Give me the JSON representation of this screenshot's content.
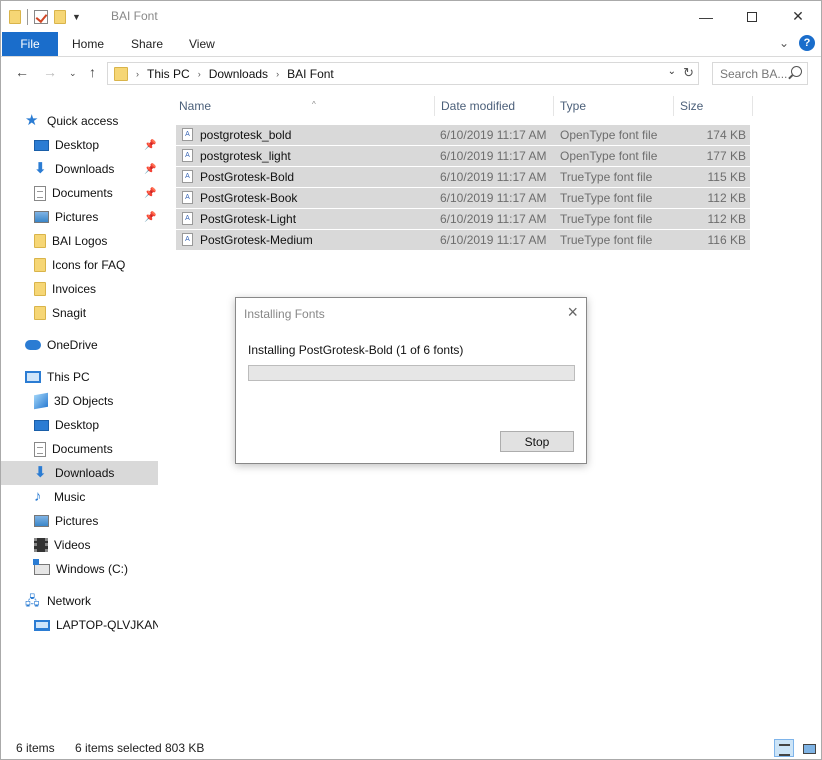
{
  "window": {
    "title": "BAI Font",
    "controls": {
      "minimize": "—",
      "maximize": "",
      "close": "✕"
    }
  },
  "ribbon": {
    "tabs": [
      "File",
      "Home",
      "Share",
      "View"
    ],
    "expand": "⌄",
    "help": "?"
  },
  "navbar": {
    "back": "←",
    "forward": "→",
    "recent": "⌄",
    "up": "↑",
    "breadcrumbs": [
      "This PC",
      "Downloads",
      "BAI Font"
    ],
    "crumb_sep": "›",
    "dropdown": "⌄",
    "refresh": "↻",
    "search_placeholder": "Search BA..."
  },
  "sidebar": {
    "quick_access": "Quick access",
    "quick_items": [
      {
        "label": "Desktop",
        "pinned": true
      },
      {
        "label": "Downloads",
        "pinned": true
      },
      {
        "label": "Documents",
        "pinned": true
      },
      {
        "label": "Pictures",
        "pinned": true
      },
      {
        "label": "BAI Logos",
        "pinned": false
      },
      {
        "label": "Icons for FAQ",
        "pinned": false
      },
      {
        "label": "Invoices",
        "pinned": false
      },
      {
        "label": "Snagit",
        "pinned": false
      }
    ],
    "onedrive": "OneDrive",
    "this_pc": "This PC",
    "pc_items": [
      "3D Objects",
      "Desktop",
      "Documents",
      "Downloads",
      "Music",
      "Pictures",
      "Videos",
      "Windows (C:)"
    ],
    "selected": "Downloads",
    "network": "Network",
    "network_items": [
      "LAPTOP-QLVJKANU"
    ]
  },
  "filelist": {
    "columns": [
      "Name",
      "Date modified",
      "Type",
      "Size"
    ],
    "rows": [
      {
        "name": "postgrotesk_bold",
        "date": "6/10/2019 11:17 AM",
        "type": "OpenType font file",
        "size": "174 KB"
      },
      {
        "name": "postgrotesk_light",
        "date": "6/10/2019 11:17 AM",
        "type": "OpenType font file",
        "size": "177 KB"
      },
      {
        "name": "PostGrotesk-Bold",
        "date": "6/10/2019 11:17 AM",
        "type": "TrueType font file",
        "size": "115 KB"
      },
      {
        "name": "PostGrotesk-Book",
        "date": "6/10/2019 11:17 AM",
        "type": "TrueType font file",
        "size": "112 KB"
      },
      {
        "name": "PostGrotesk-Light",
        "date": "6/10/2019 11:17 AM",
        "type": "TrueType font file",
        "size": "112 KB"
      },
      {
        "name": "PostGrotesk-Medium",
        "date": "6/10/2019 11:17 AM",
        "type": "TrueType font file",
        "size": "116 KB"
      }
    ]
  },
  "dialog": {
    "title": "Installing Fonts",
    "message": "Installing PostGrotesk-Bold (1 of 6 fonts)",
    "progress": 0,
    "progress_color": "#06b025",
    "stop_label": "Stop"
  },
  "statusbar": {
    "item_count": "6 items",
    "selected": "6 items selected",
    "size": "803 KB"
  }
}
